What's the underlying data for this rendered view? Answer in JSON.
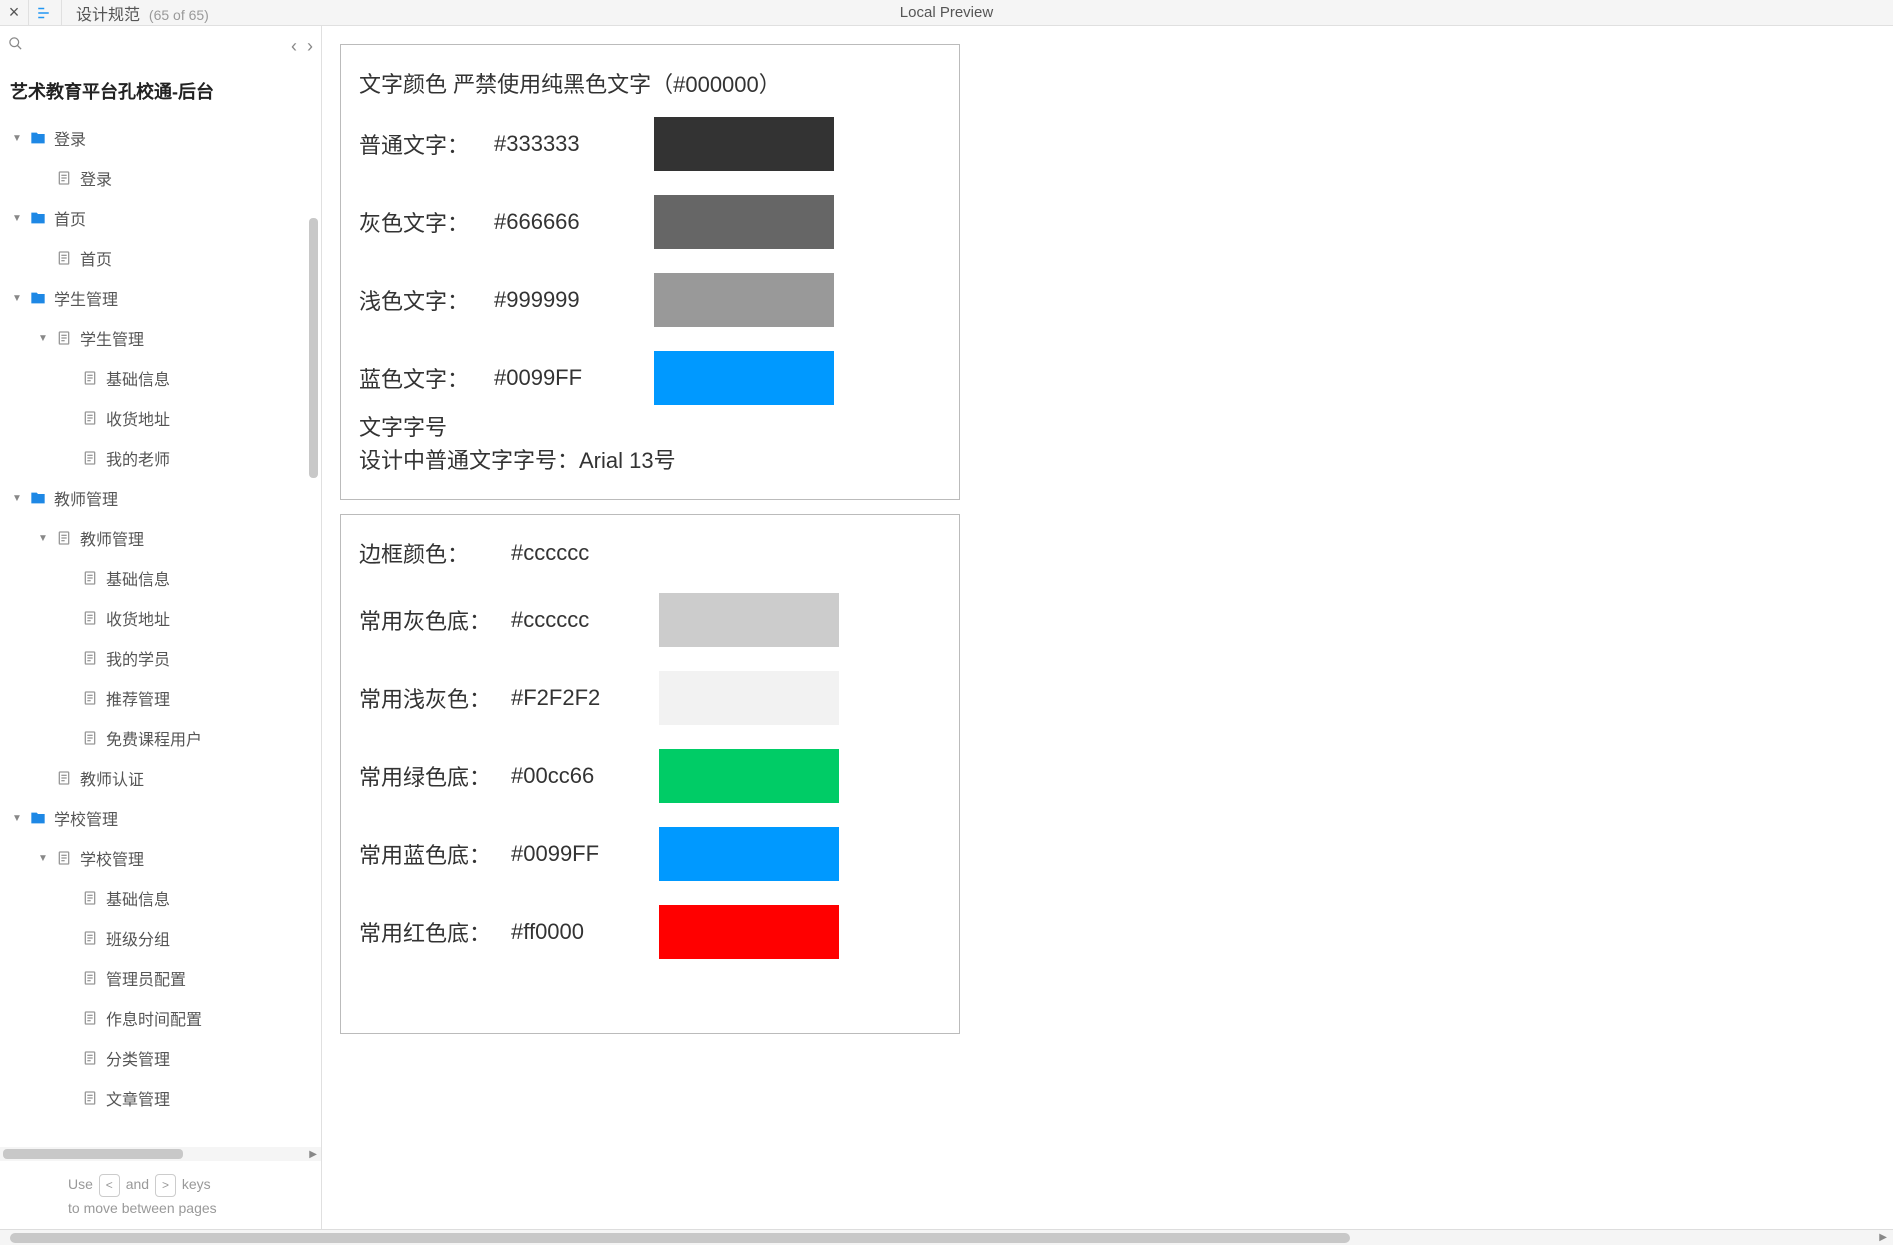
{
  "topbar": {
    "page_name": "设计规范",
    "page_count": "(65 of 65)",
    "center": "Local Preview"
  },
  "sidebar": {
    "title": "艺术教育平台孔校通-后台",
    "hint_prefix": "Use",
    "hint_key_left": "<",
    "hint_mid": "and",
    "hint_key_right": ">",
    "hint_suffix": "keys",
    "hint_line2": "to move between pages",
    "tree": [
      {
        "level": 0,
        "type": "folder",
        "arrow": "open",
        "label": "登录"
      },
      {
        "level": 1,
        "type": "page",
        "arrow": "none",
        "label": "登录"
      },
      {
        "level": 0,
        "type": "folder",
        "arrow": "open",
        "label": "首页"
      },
      {
        "level": 1,
        "type": "page",
        "arrow": "none",
        "label": "首页"
      },
      {
        "level": 0,
        "type": "folder",
        "arrow": "open",
        "label": "学生管理"
      },
      {
        "level": 1,
        "type": "page",
        "arrow": "open",
        "label": "学生管理"
      },
      {
        "level": 2,
        "type": "page",
        "arrow": "none",
        "label": "基础信息"
      },
      {
        "level": 2,
        "type": "page",
        "arrow": "none",
        "label": "收货地址"
      },
      {
        "level": 2,
        "type": "page",
        "arrow": "none",
        "label": "我的老师"
      },
      {
        "level": 0,
        "type": "folder",
        "arrow": "open",
        "label": "教师管理"
      },
      {
        "level": 1,
        "type": "page",
        "arrow": "open",
        "label": "教师管理"
      },
      {
        "level": 2,
        "type": "page",
        "arrow": "none",
        "label": "基础信息"
      },
      {
        "level": 2,
        "type": "page",
        "arrow": "none",
        "label": "收货地址"
      },
      {
        "level": 2,
        "type": "page",
        "arrow": "none",
        "label": "我的学员"
      },
      {
        "level": 2,
        "type": "page",
        "arrow": "none",
        "label": "推荐管理"
      },
      {
        "level": 2,
        "type": "page",
        "arrow": "none",
        "label": "免费课程用户"
      },
      {
        "level": 1,
        "type": "page",
        "arrow": "none",
        "label": "教师认证"
      },
      {
        "level": 0,
        "type": "folder",
        "arrow": "open",
        "label": "学校管理"
      },
      {
        "level": 1,
        "type": "page",
        "arrow": "open",
        "label": "学校管理"
      },
      {
        "level": 2,
        "type": "page",
        "arrow": "none",
        "label": "基础信息"
      },
      {
        "level": 2,
        "type": "page",
        "arrow": "none",
        "label": "班级分组"
      },
      {
        "level": 2,
        "type": "page",
        "arrow": "none",
        "label": "管理员配置"
      },
      {
        "level": 2,
        "type": "page",
        "arrow": "none",
        "label": "作息时间配置"
      },
      {
        "level": 2,
        "type": "page",
        "arrow": "none",
        "label": "分类管理"
      },
      {
        "level": 2,
        "type": "page",
        "arrow": "none",
        "label": "文章管理"
      }
    ]
  },
  "content": {
    "panel1": {
      "heading": "文字颜色   严禁使用纯黑色文字（#000000）",
      "rows": [
        {
          "label": "普通文字：",
          "val": "#333333",
          "color": "#333333"
        },
        {
          "label": "灰色文字：",
          "val": "#666666",
          "color": "#666666"
        },
        {
          "label": "浅色文字：",
          "val": "#999999",
          "color": "#999999"
        },
        {
          "label": "蓝色文字：",
          "val": "#0099FF",
          "color": "#0099FF"
        }
      ],
      "font_title": "文字字号",
      "font_desc": "设计中普通文字字号：Arial 13号"
    },
    "panel2": {
      "border_row": {
        "label": "边框颜色：",
        "val": "#cccccc"
      },
      "rows": [
        {
          "label": "常用灰色底：",
          "val": "#cccccc",
          "color": "#cccccc"
        },
        {
          "label": "常用浅灰色：",
          "val": "#F2F2F2",
          "color": "#F2F2F2"
        },
        {
          "label": "常用绿色底：",
          "val": "#00cc66",
          "color": "#00cc66"
        },
        {
          "label": "常用蓝色底：",
          "val": "#0099FF",
          "color": "#0099FF"
        },
        {
          "label": "常用红色底：",
          "val": "#ff0000",
          "color": "#ff0000"
        }
      ]
    }
  }
}
